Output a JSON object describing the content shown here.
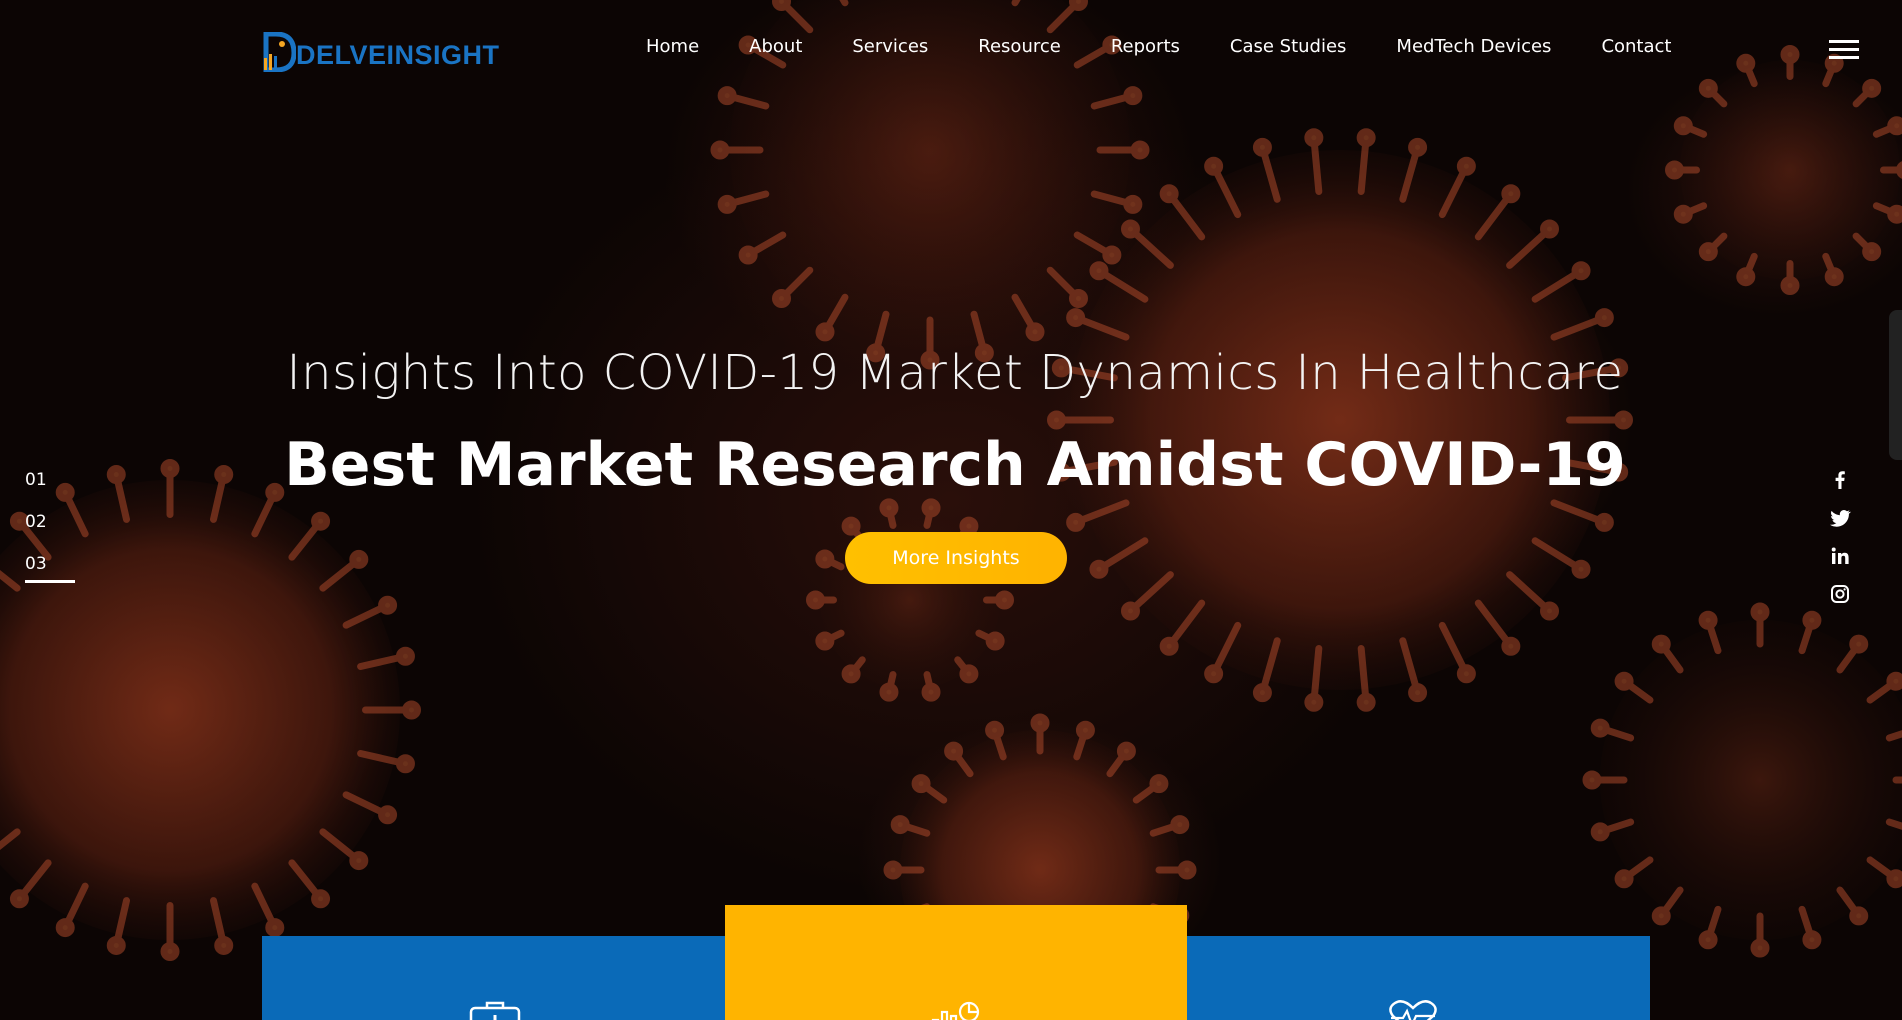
{
  "brand": {
    "logo_text": "DELVEINSIGHT",
    "primary_color": "#1a74c4",
    "accent_color": "#ffb400"
  },
  "nav": {
    "items": [
      "Home",
      "About",
      "Services",
      "Resource",
      "Reports",
      "Case Studies",
      "MedTech Devices",
      "Contact"
    ],
    "menu_icon": "hamburger-icon"
  },
  "hero": {
    "subtitle": "Insights Into COVID-19 Market Dynamics In Healthcare",
    "headline": "Best Market Research Amidst COVID-19",
    "cta_label": "More Insights",
    "slides": [
      "01",
      "02",
      "03"
    ],
    "active_slide": "03"
  },
  "social": [
    "facebook-icon",
    "twitter-icon",
    "linkedin-icon",
    "instagram-icon"
  ],
  "cards": [
    {
      "icon": "medical-kit-icon",
      "color": "#0a6ab8"
    },
    {
      "icon": "analytics-icon",
      "color": "#ffb400"
    },
    {
      "icon": "heartbeat-monitor-icon",
      "color": "#0a6ab8"
    }
  ]
}
